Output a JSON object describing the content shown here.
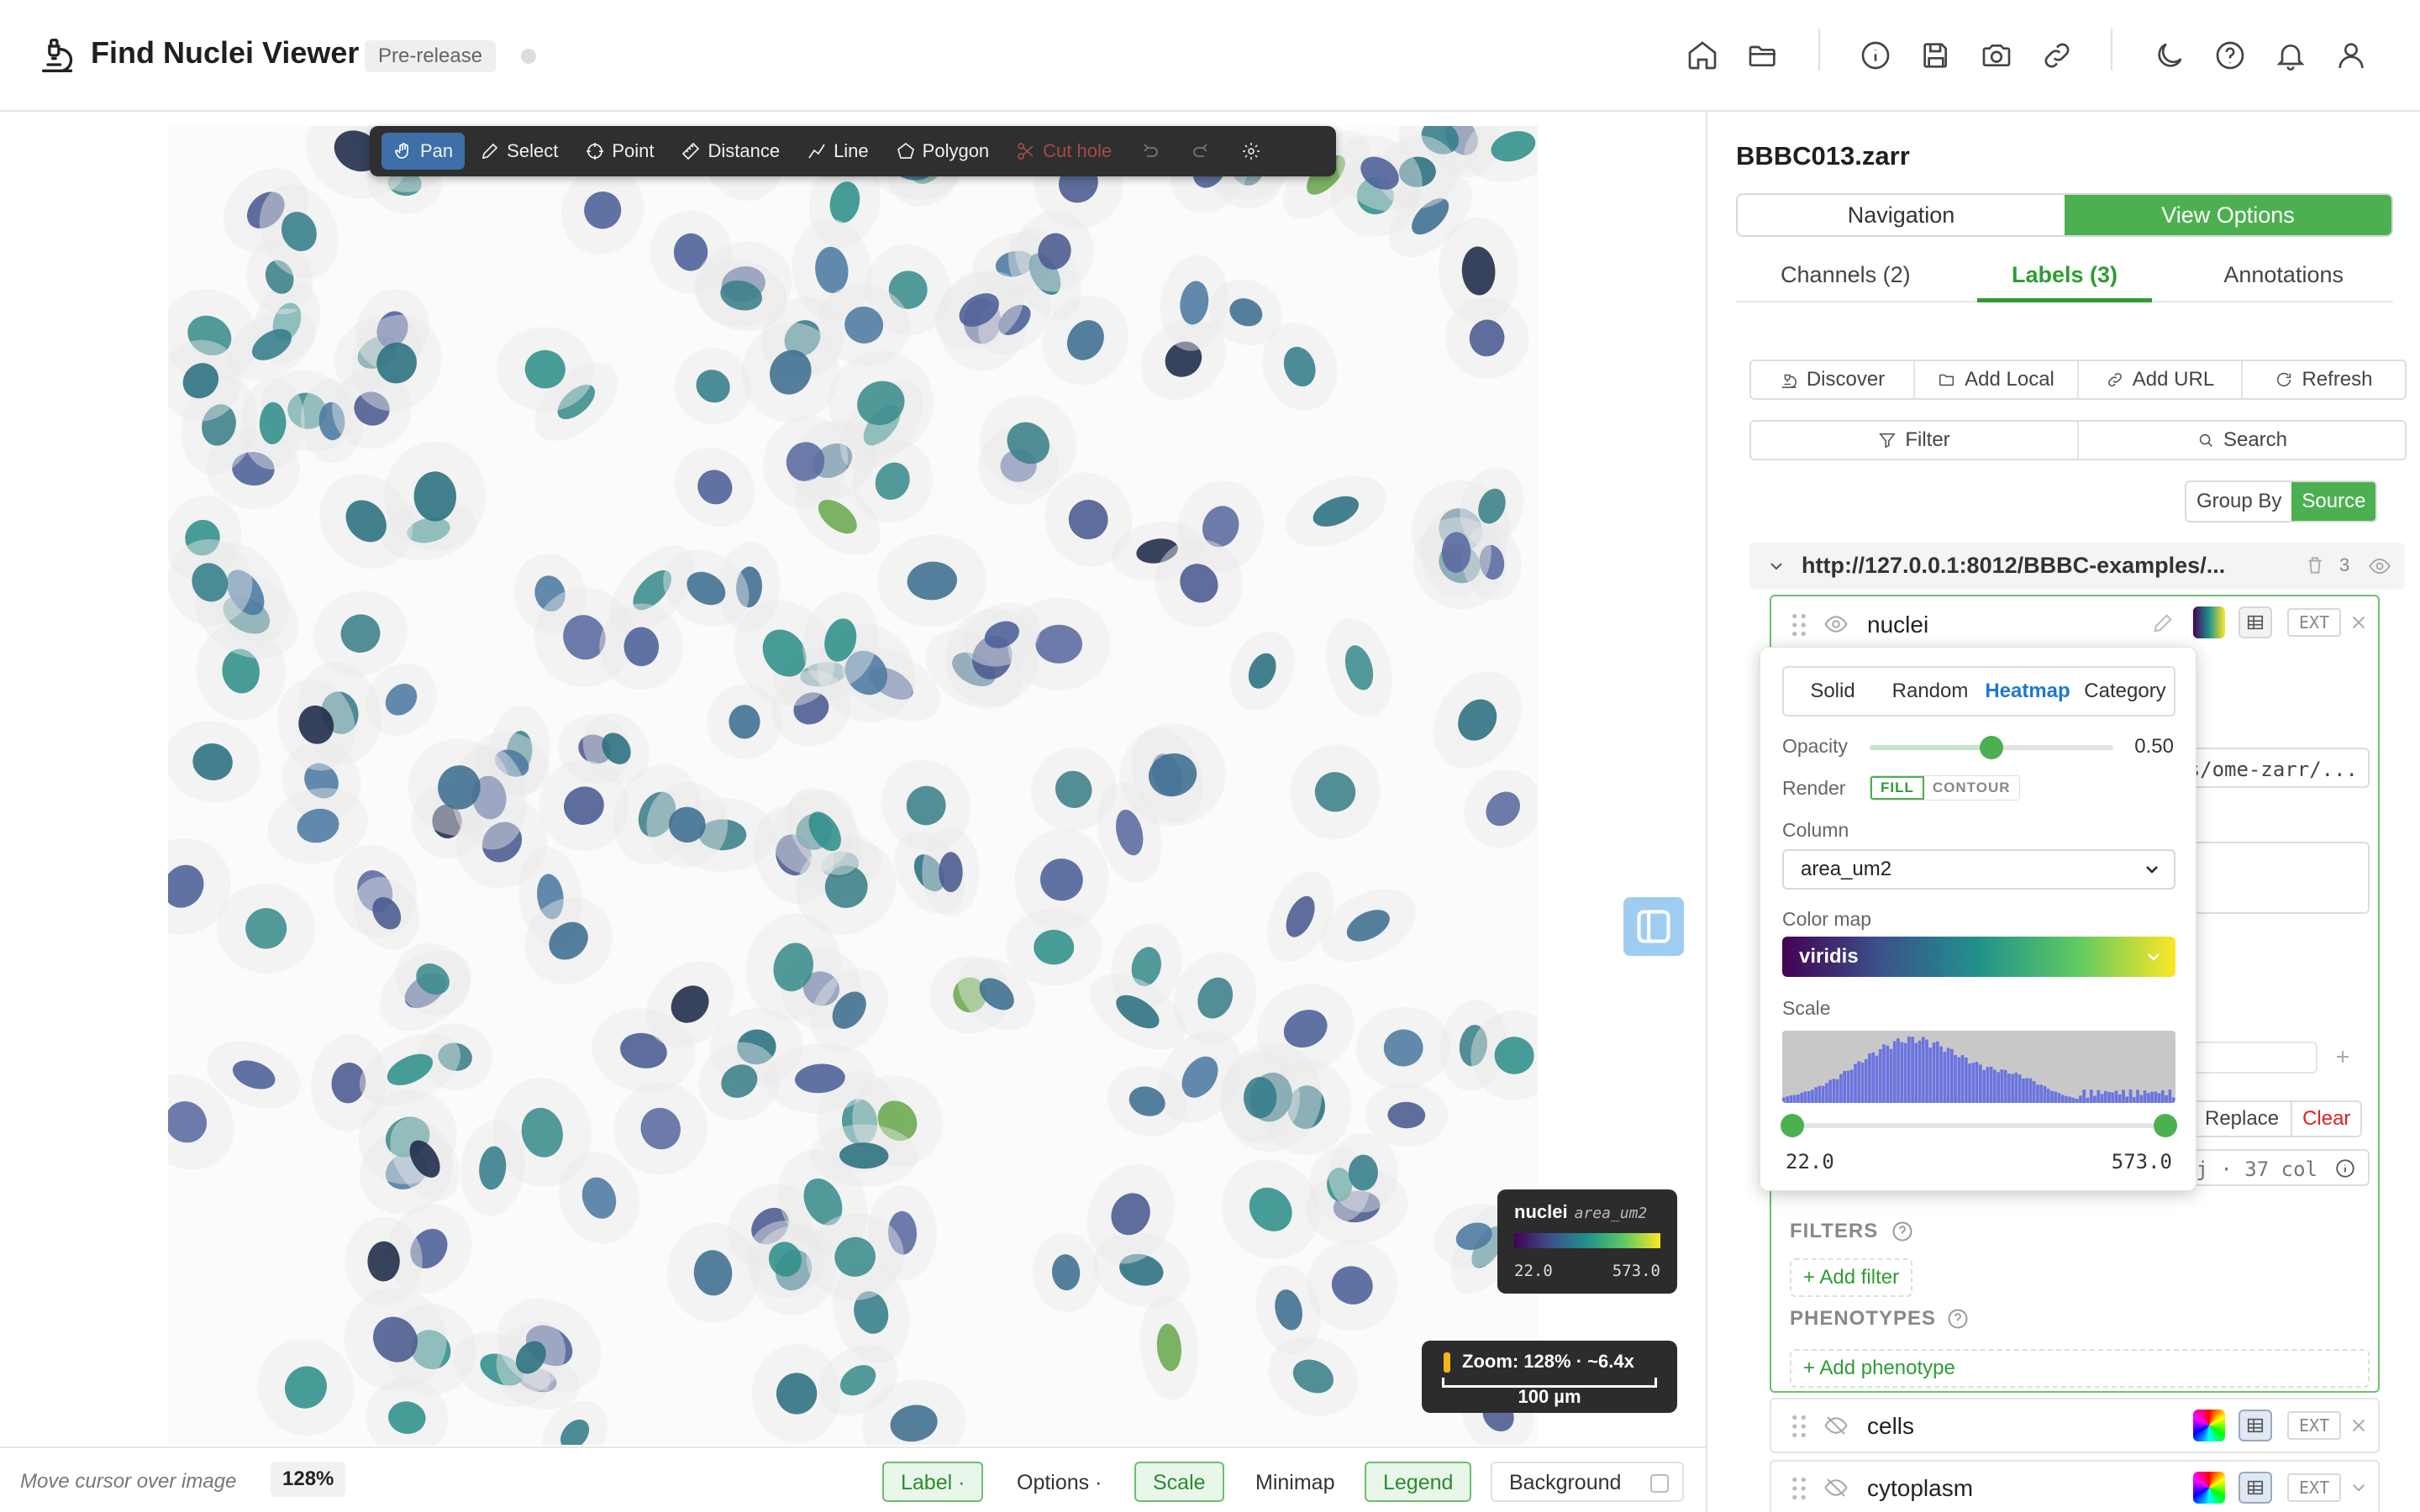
{
  "header": {
    "title": "Find Nuclei Viewer",
    "badge": "Pre-release",
    "icons": [
      "home-icon",
      "folder-icon",
      "info-icon",
      "save-icon",
      "camera-icon",
      "link-icon",
      "moon-icon",
      "help-icon",
      "bell-icon",
      "user-icon"
    ]
  },
  "toolbar": {
    "tools": [
      {
        "label": "Pan",
        "icon": "hand-icon",
        "active": true
      },
      {
        "label": "Select",
        "icon": "pencil-icon"
      },
      {
        "label": "Point",
        "icon": "crosshair-icon"
      },
      {
        "label": "Distance",
        "icon": "ruler-icon"
      },
      {
        "label": "Line",
        "icon": "polyline-icon"
      },
      {
        "label": "Polygon",
        "icon": "pentagon-icon"
      },
      {
        "label": "Cut hole",
        "icon": "scissors-icon",
        "disabled": true
      }
    ]
  },
  "legend": {
    "layer": "nuclei",
    "column": "area_um2",
    "min": "22.0",
    "max": "573.0"
  },
  "scale": {
    "zoom": "Zoom: 128% · ~6.4x",
    "bar_label": "100 µm"
  },
  "statusbar": {
    "cursor_text": "Move cursor over image",
    "zoom_pct": "128%",
    "label_btn": "Label ·",
    "options_btn": "Options ·",
    "scale_btn": "Scale",
    "minimap_btn": "Minimap",
    "legend_btn": "Legend",
    "background_btn": "Background"
  },
  "panel": {
    "dataset": "BBBC013.zarr",
    "segments": [
      "Navigation",
      "View Options"
    ],
    "tabs": [
      "Channels (2)",
      "Labels (3)",
      "Annotations"
    ],
    "actions": [
      "Discover",
      "Add Local",
      "Add URL",
      "Refresh"
    ],
    "filter": "Filter",
    "search": "Search",
    "group_by": "Group By",
    "group_value": "Source",
    "source_url": "http://127.0.0.1:8012/BBBC-examples/...",
    "source_count": "3",
    "layers": [
      {
        "name": "nuclei",
        "ext": "EXT"
      },
      {
        "name": "cells",
        "ext": "EXT"
      },
      {
        "name": "cytoplasm",
        "ext": "EXT"
      }
    ],
    "path_fragment": "es/ome-zarr/...",
    "replace": "Replace",
    "clear": "Clear",
    "cols_fragment": "j · 37 col",
    "filters_label": "FILTERS",
    "add_filter": "+ Add filter",
    "phenotypes_label": "PHENOTYPES",
    "add_phenotype": "+ Add phenotype"
  },
  "popover": {
    "modes": [
      "Solid",
      "Random",
      "Heatmap",
      "Category"
    ],
    "active_mode": "Heatmap",
    "opacity_label": "Opacity",
    "opacity": 0.5,
    "opacity_text": "0.50",
    "render_label": "Render",
    "render_options": [
      "FILL",
      "CONTOUR"
    ],
    "column_label": "Column",
    "column_value": "area_um2",
    "colormap_label": "Color map",
    "colormap_value": "viridis",
    "scale_label": "Scale",
    "range_min": "22.0",
    "range_max": "573.0"
  },
  "colors": {
    "accent_green": "#4cb050",
    "heatmap_blue": "#1e79c9",
    "toolbar_bg": "#2f2f2f"
  }
}
